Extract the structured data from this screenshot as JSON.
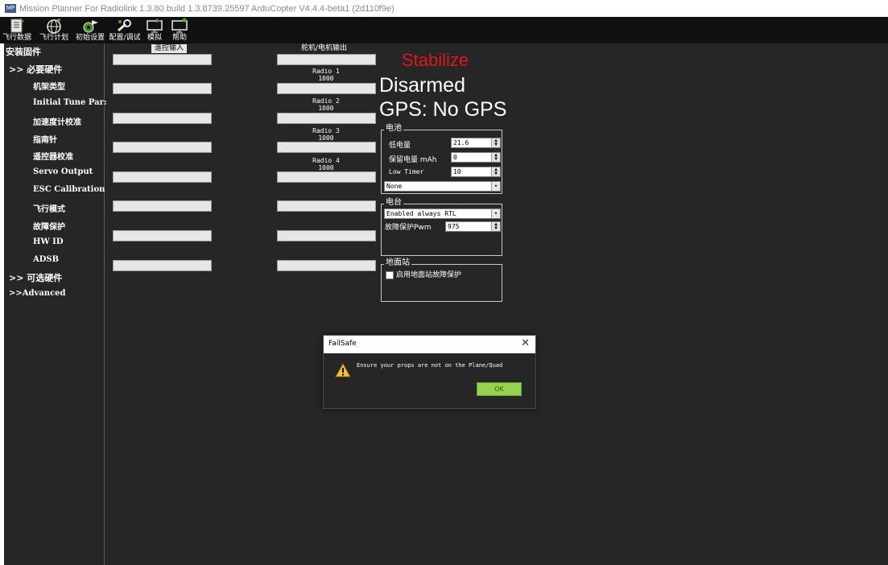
{
  "window": {
    "title": "Mission Planner For Radiolink 1.3.80 build 1.3.8739.25597 ArduCopter V4.4.4-beta1 (2d110f9e)",
    "app_icon_text": "MP"
  },
  "toolbar": {
    "buttons": [
      {
        "label": "飞行数据",
        "icon": "document-icon"
      },
      {
        "label": "飞行计划",
        "icon": "globe-icon"
      },
      {
        "label": "初始设置",
        "icon": "gear-plane-icon"
      },
      {
        "label": "配置/调试",
        "icon": "wrench-icon"
      },
      {
        "label": "模拟",
        "icon": "monitor-plane-icon"
      },
      {
        "label": "帮助",
        "icon": "monitor-help-icon"
      }
    ],
    "active_index": 2
  },
  "sidebar": {
    "items": [
      {
        "label": "安装固件"
      },
      {
        "label": ">> 必要硬件"
      },
      {
        "label": "机架类型"
      },
      {
        "label": "Initial Tune Par:"
      },
      {
        "label": "加速度计校准"
      },
      {
        "label": "指南针"
      },
      {
        "label": "遥控器校准"
      },
      {
        "label": "Servo Output"
      },
      {
        "label": "ESC Calibration"
      },
      {
        "label": "飞行模式"
      },
      {
        "label": "故障保护"
      },
      {
        "label": "HW ID"
      },
      {
        "label": "ADSB"
      },
      {
        "label": ">> 可选硬件"
      },
      {
        "label": ">>Advanced"
      }
    ]
  },
  "rc_input": {
    "title": "遥控输入"
  },
  "servo_output": {
    "title": "舵机/电机输出",
    "radios": [
      {
        "name": "Radio 1",
        "value": "1000"
      },
      {
        "name": "Radio 2",
        "value": "1000"
      },
      {
        "name": "Radio 3",
        "value": "1000"
      },
      {
        "name": "Radio 4",
        "value": "1000"
      }
    ]
  },
  "status": {
    "mode": "Stabilize",
    "armed": "Disarmed",
    "gps": "GPS: No GPS",
    "mode_color": "#e01818"
  },
  "battery": {
    "title": "电池",
    "low_voltage_label": "低电量",
    "low_voltage_value": "21.6",
    "reserve_mah_label": "保留电量 mAh",
    "reserve_mah_value": "0",
    "low_timer_label": "Low Timer",
    "low_timer_value": "10",
    "action_value": "None"
  },
  "radio": {
    "title": "电台",
    "action_value": "Enabled always RTL",
    "pwm_label": "故障保护Pwm",
    "pwm_value": "975"
  },
  "gcs": {
    "title": "地面站",
    "enable_label": "启用地面站故障保护"
  },
  "dialog": {
    "title": "FailSafe",
    "close": "✕",
    "message": "Ensure your props are not on the Plane/Quad",
    "ok_label": "OK",
    "ok_color": "#95d34e"
  }
}
